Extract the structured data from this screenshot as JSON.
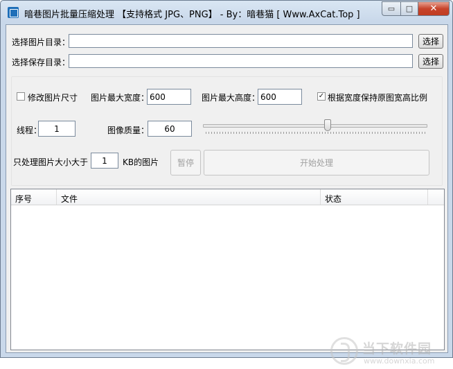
{
  "window": {
    "title": "暗巷图片批量压缩处理 【支持格式 JPG、PNG】 - By：暗巷猫 [ Www.AxCat.Top ]",
    "min_glyph": "▭",
    "max_glyph": "□",
    "close_glyph": "✕"
  },
  "dirs": {
    "source_label": "选择图片目录：",
    "source_value": "",
    "save_label": "选择保存目录：",
    "save_value": "",
    "browse_label": "选择"
  },
  "options": {
    "resize_label": "修改图片尺寸",
    "resize_checked": false,
    "max_width_label": "图片最大宽度：",
    "max_width_value": "600",
    "max_height_label": "图片最大高度：",
    "max_height_value": "600",
    "keep_ratio_label": "根据宽度保持原图宽高比例",
    "keep_ratio_checked": true,
    "keep_ratio_mark": "✓",
    "threads_label": "线程：",
    "threads_value": "1",
    "quality_label": "图像质量：",
    "quality_value": "60",
    "quality_slider": 0.6,
    "min_size_label": "只处理图片大小大于",
    "min_size_value": "1",
    "min_size_unit": "KB的图片"
  },
  "actions": {
    "pause_label": "暂停",
    "start_label": "开始处理"
  },
  "list": {
    "columns": [
      "序号",
      "文件",
      "状态"
    ],
    "rows": []
  },
  "watermark": {
    "cn": "当下软件园",
    "en": "www.downxia.com"
  }
}
